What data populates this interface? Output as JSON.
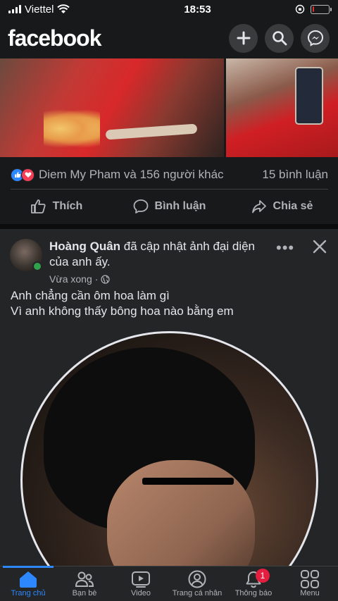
{
  "status_bar": {
    "carrier": "Viettel",
    "time": "18:53",
    "battery_percent": 10
  },
  "header": {
    "logo": "facebook"
  },
  "previous_post": {
    "reactions_text": "Diem My Pham và 156 người khác",
    "comments_text": "15 bình luận",
    "actions": {
      "like": "Thích",
      "comment": "Bình luận",
      "share": "Chia sẻ"
    }
  },
  "post": {
    "author": "Hoàng Quân",
    "action_text": "đã cập nhật ảnh đại diện của anh ấy.",
    "time": "Vừa xong",
    "privacy_sep": "·",
    "more": "•••",
    "text_line1": "Anh chẳng cần ôm hoa làm gì",
    "text_line2": "Vì anh không thấy bông hoa nào bằng em"
  },
  "tabbar": {
    "items": [
      {
        "label": "Trang chủ",
        "icon": "home-icon",
        "active": true
      },
      {
        "label": "Bạn bè",
        "icon": "friends-icon"
      },
      {
        "label": "Video",
        "icon": "video-icon"
      },
      {
        "label": "Trang cá nhân",
        "icon": "profile-icon"
      },
      {
        "label": "Thông báo",
        "icon": "bell-icon",
        "badge": "1"
      },
      {
        "label": "Menu",
        "icon": "menu-icon"
      }
    ]
  },
  "colors": {
    "accent": "#2d88ff",
    "background": "#18191a",
    "card": "#242526",
    "badge": "#e41e3f",
    "online": "#31a24c"
  }
}
